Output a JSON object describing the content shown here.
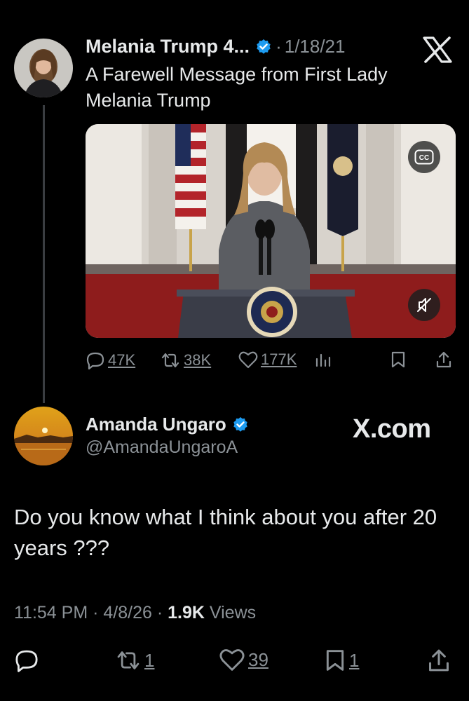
{
  "quoted_tweet": {
    "author_name": "Melania Trump 4...",
    "separator": "·",
    "date": "1/18/21",
    "text": "A Farewell Message from First Lady Melania Trump",
    "stats": {
      "replies": "47K",
      "reposts": "38K",
      "likes": "177K"
    },
    "video": {
      "cc_label": "CC"
    }
  },
  "main_tweet": {
    "author_name": "Amanda Ungaro",
    "handle": "@AmandaUngaroA",
    "source_label": "X.com",
    "text": "Do you know what I think about you after 20 years ???",
    "time": "11:54 PM",
    "sep1": "·",
    "date": "4/8/26",
    "sep2": "·",
    "views_count": "1.9K",
    "views_label": "Views",
    "stats": {
      "reposts": "1",
      "likes": "39",
      "bookmarks": "1"
    }
  },
  "colors": {
    "background": "#000000",
    "text_primary": "#e7e9ea",
    "text_secondary": "#8b9196",
    "verified_blue": "#1d9bf0"
  },
  "icons": [
    "verified-badge-icon",
    "x-logo-icon",
    "cc-icon",
    "mute-icon",
    "reply-icon",
    "repost-icon",
    "like-icon",
    "analytics-icon",
    "bookmark-icon",
    "share-icon"
  ]
}
